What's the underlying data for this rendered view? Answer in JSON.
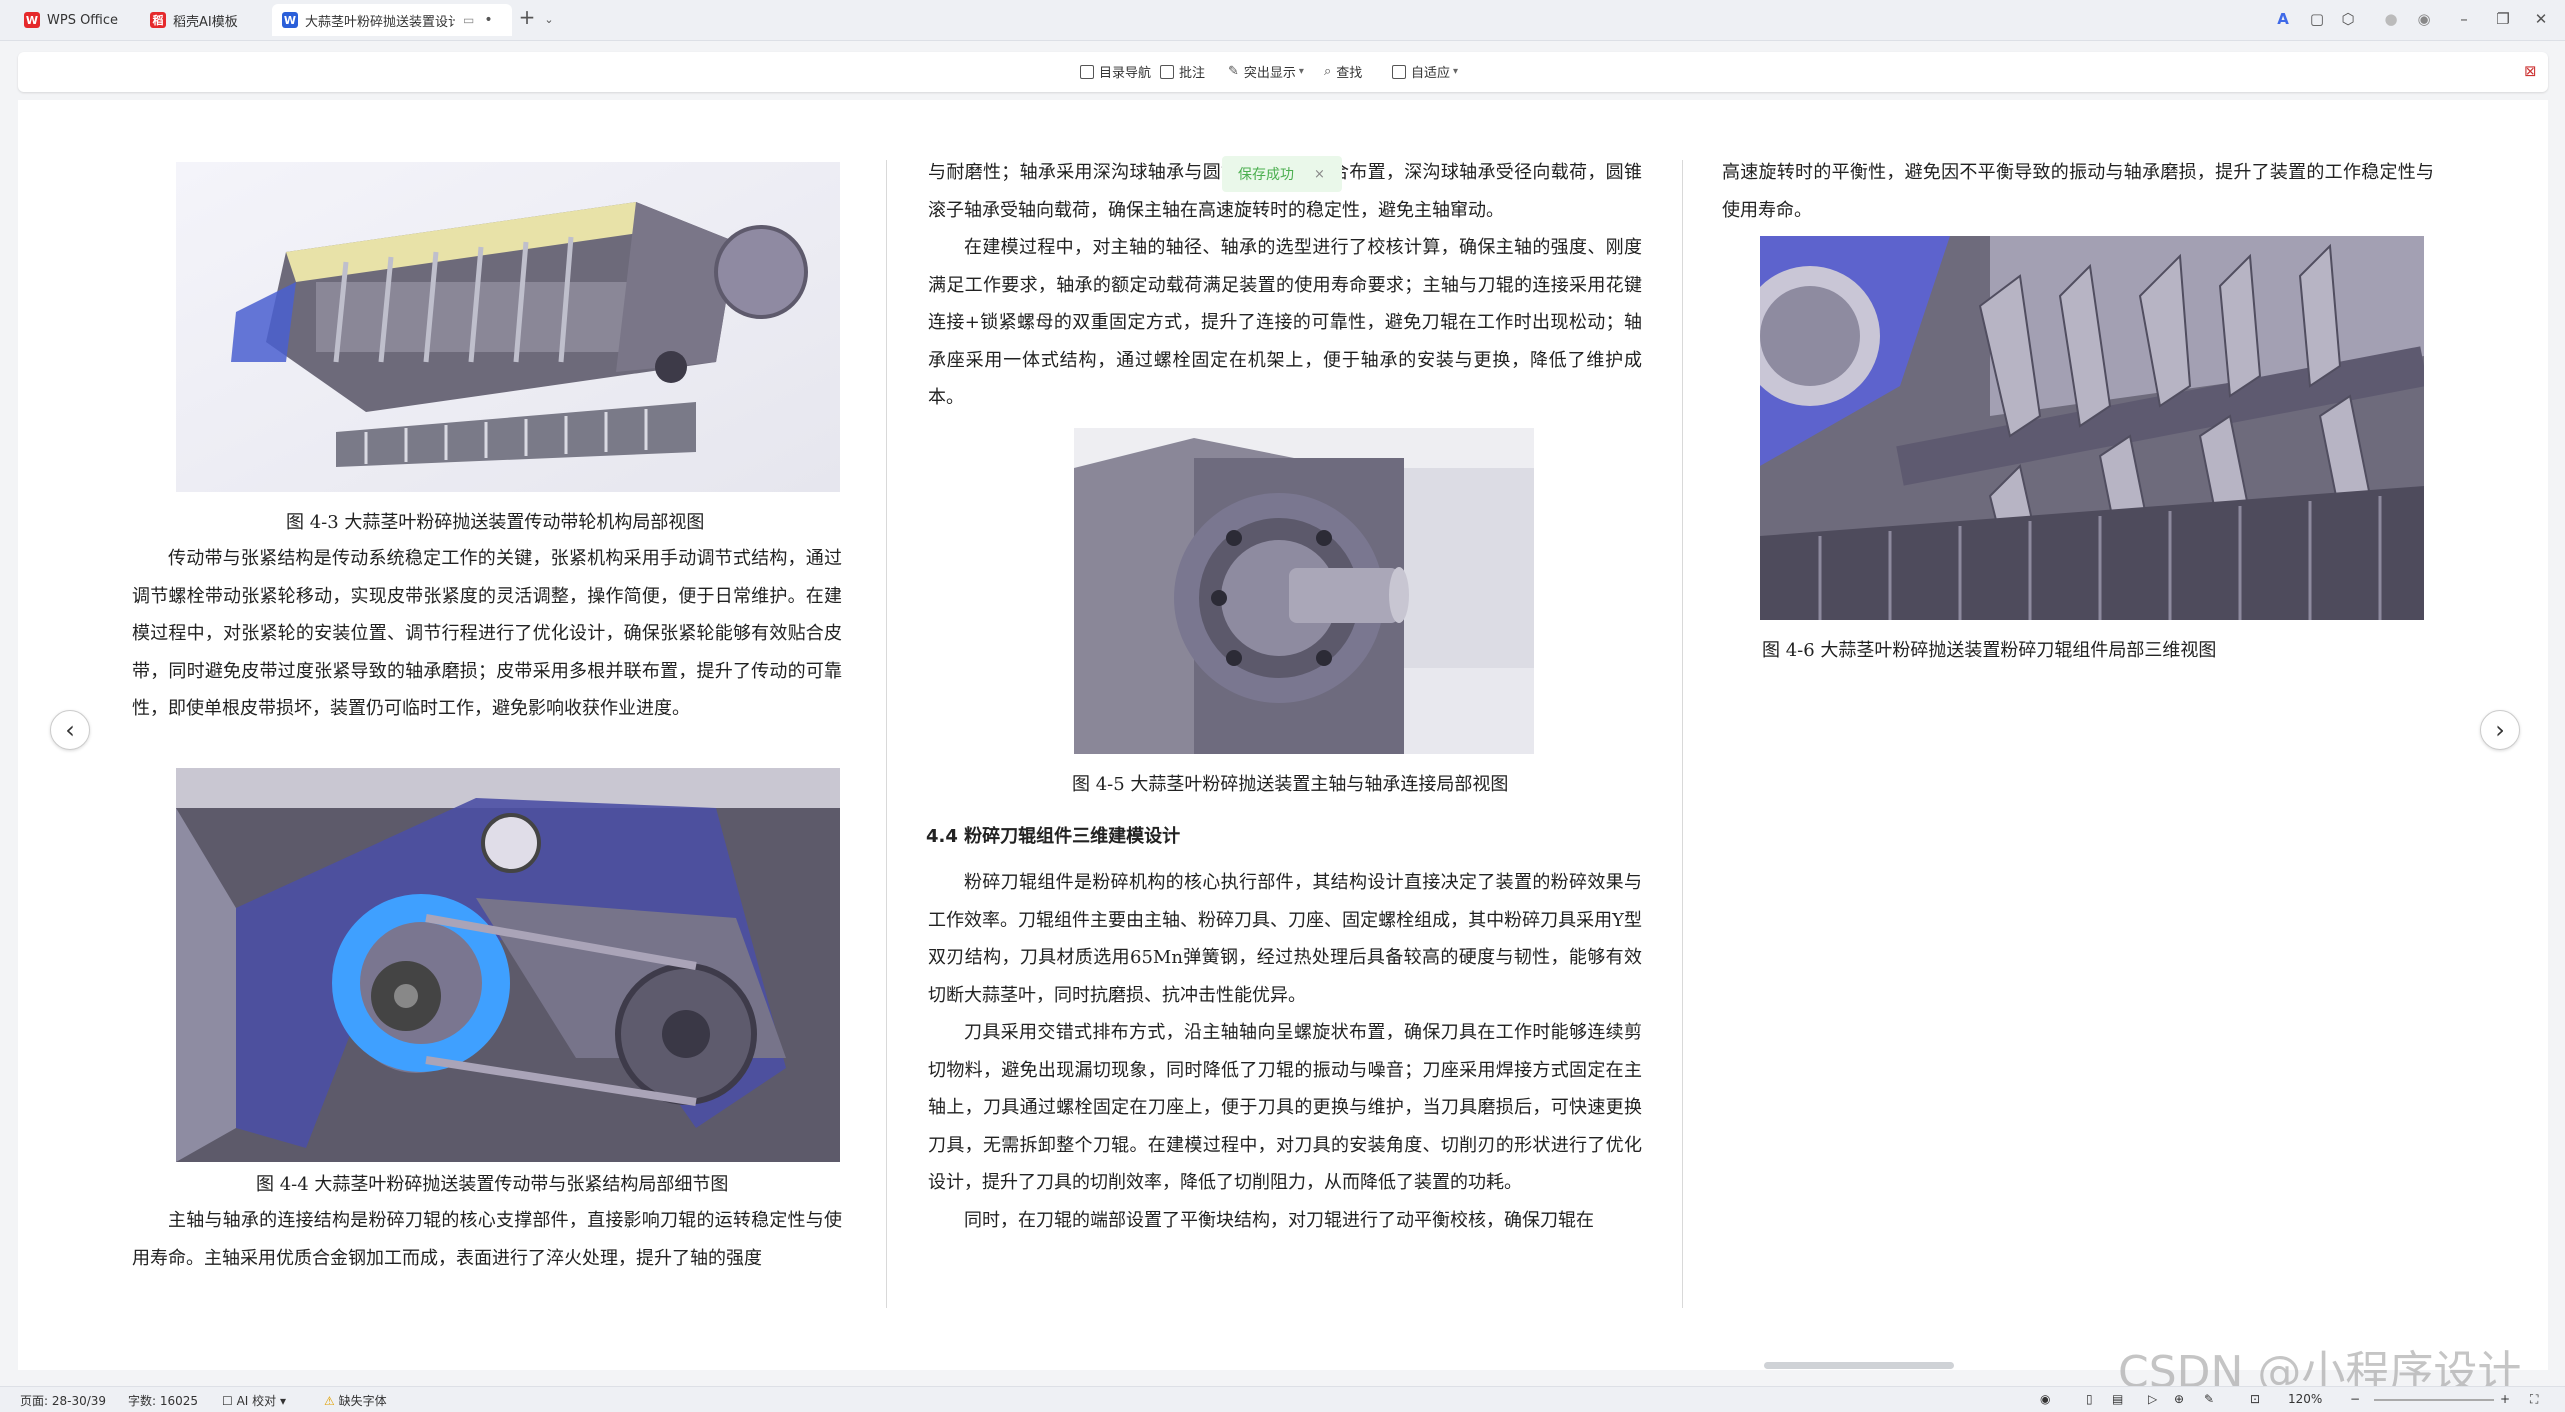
{
  "tabs": [
    {
      "label": "WPS Office",
      "icon": "wps-logo-icon",
      "color": "#e5292b"
    },
    {
      "label": "稻壳AI模板",
      "icon": "docer-logo-icon",
      "color": "#e5292b"
    },
    {
      "label": "大蒜茎叶粉碎抛送装置设计.d",
      "icon": "word-doc-icon",
      "color": "#2b5fd9"
    }
  ],
  "toolbar": {
    "toc": "目录导航",
    "comment": "批注",
    "highlight": "突出显示",
    "find": "查找",
    "fit": "自适应"
  },
  "toast": {
    "text": "保存成功",
    "close": "×"
  },
  "doc": {
    "col1": {
      "fig3_caption": "图 4-3 大蒜茎叶粉碎抛送装置传动带轮机构局部视图",
      "para1": "传动带与张紧结构是传动系统稳定工作的关键，张紧机构采用手动调节式结构，通过调节螺栓带动张紧轮移动，实现皮带张紧度的灵活调整，操作简便，便于日常维护。在建模过程中，对张紧轮的安装位置、调节行程进行了优化设计，确保张紧轮能够有效贴合皮带，同时避免皮带过度张紧导致的轴承磨损；皮带采用多根并联布置，提升了传动的可靠性，即使单根皮带损坏，装置仍可临时工作，避免影响收获作业进度。",
      "fig4_caption": "图 4-4 大蒜茎叶粉碎抛送装置传动带与张紧结构局部细节图",
      "para2": "主轴与轴承的连接结构是粉碎刀辊的核心支撑部件，直接影响刀辊的运转稳定性与使用寿命。主轴采用优质合金钢加工而成，表面进行了淬火处理，提升了轴的强度"
    },
    "col2": {
      "para1": "与耐磨性；轴承采用深沟球轴承与圆锥滚子轴承组合布置，深沟球轴承受径向载荷，圆锥滚子轴承受轴向载荷，确保主轴在高速旋转时的稳定性，避免主轴窜动。",
      "para2": "在建模过程中，对主轴的轴径、轴承的选型进行了校核计算，确保主轴的强度、刚度满足工作要求，轴承的额定动载荷满足装置的使用寿命要求；主轴与刀辊的连接采用花键连接+锁紧螺母的双重固定方式，提升了连接的可靠性，避免刀辊在工作时出现松动；轴承座采用一体式结构，通过螺栓固定在机架上，便于轴承的安装与更换，降低了维护成本。",
      "fig5_caption": "图 4-5 大蒜茎叶粉碎抛送装置主轴与轴承连接局部视图",
      "heading": "4.4 粉碎刀辊组件三维建模设计",
      "para3": "粉碎刀辊组件是粉碎机构的核心执行部件，其结构设计直接决定了装置的粉碎效果与工作效率。刀辊组件主要由主轴、粉碎刀具、刀座、固定螺栓组成，其中粉碎刀具采用Y型双刃结构，刀具材质选用65Mn弹簧钢，经过热处理后具备较高的硬度与韧性，能够有效切断大蒜茎叶，同时抗磨损、抗冲击性能优异。",
      "para4": "刀具采用交错式排布方式，沿主轴轴向呈螺旋状布置，确保刀具在工作时能够连续剪切物料，避免出现漏切现象，同时降低了刀辊的振动与噪音；刀座采用焊接方式固定在主轴上，刀具通过螺栓固定在刀座上，便于刀具的更换与维护，当刀具磨损后，可快速更换刀具，无需拆卸整个刀辊。在建模过程中，对刀具的安装角度、切削刃的形状进行了优化设计，提升了刀具的切削效率，降低了切削阻力，从而降低了装置的功耗。",
      "para5": "同时，在刀辊的端部设置了平衡块结构，对刀辊进行了动平衡校核，确保刀辊在"
    },
    "col3": {
      "para1": "高速旋转时的平衡性，避免因不平衡导致的振动与轴承磨损，提升了装置的工作稳定性与使用寿命。",
      "fig6_caption": "图 4-6 大蒜茎叶粉碎抛送装置粉碎刀辊组件局部三维视图"
    }
  },
  "status": {
    "pages": "页面: 28-30/39",
    "words": "字数: 16025",
    "ai_check": "AI 校对",
    "missing_font": "缺失字体",
    "zoom": "120%"
  },
  "watermark": "CSDN @小程序设计"
}
